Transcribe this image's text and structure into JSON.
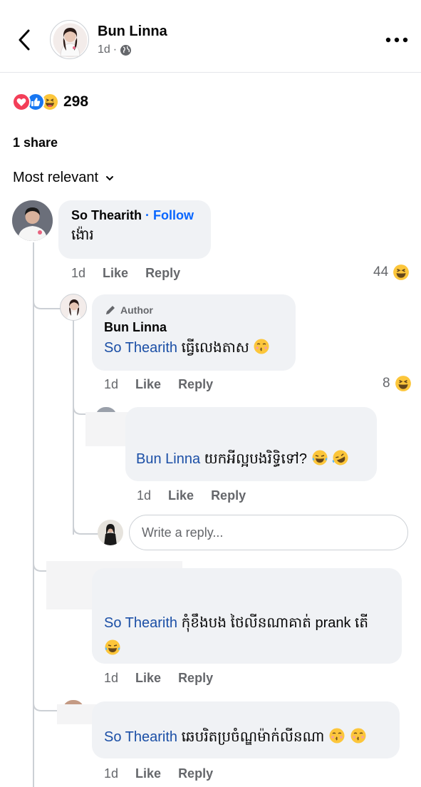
{
  "header": {
    "name": "Bun Linna",
    "time": "1d",
    "separator": "·"
  },
  "post": {
    "reaction_count": "298",
    "share_text": "1 share",
    "sort_label": "Most relevant"
  },
  "comments": [
    {
      "author": "So Thearith",
      "follow": "Follow",
      "separator": "·",
      "text": "ង៉ោរ",
      "time": "1d",
      "like": "Like",
      "reply": "Reply",
      "reaction_tally": "44"
    }
  ],
  "reply1": {
    "badge": "Author",
    "author": "Bun Linna",
    "mention": "So Thearith",
    "text": " ធ្វើលេងតាស",
    "time": "1d",
    "like": "Like",
    "reply": "Reply",
    "reaction_tally": "8"
  },
  "reply2": {
    "mention": "Bun Linna",
    "text": " យកអីល្អបងរិទ្ធិទៅ?",
    "time": "1d",
    "like": "Like",
    "reply": "Reply"
  },
  "reply_input": {
    "placeholder": "Write a reply..."
  },
  "reply3": {
    "mention": "So Thearith",
    "text": " កុំខឹងបង ថៃលីនណាគាត់ prank តើ",
    "time": "1d",
    "like": "Like",
    "reply": "Reply"
  },
  "reply4": {
    "mention": "So Thearith",
    "text": " ឆេបរិតប្រចំណ្ឌម៉ាក់លីនណា",
    "time": "1d",
    "like": "Like",
    "reply": "Reply"
  },
  "colors": {
    "accent": "#0866ff",
    "mention": "#1b4fa6",
    "bubble": "#f0f2f5",
    "muted": "#65676b"
  },
  "icons": [
    "back-arrow-icon",
    "globe-icon",
    "more-icon",
    "love-reaction-icon",
    "like-reaction-icon",
    "haha-reaction-icon",
    "chevron-down-icon",
    "pencil-icon",
    "laughing-emoji-icon",
    "rofl-emoji-icon",
    "kissing-emoji-icon"
  ]
}
